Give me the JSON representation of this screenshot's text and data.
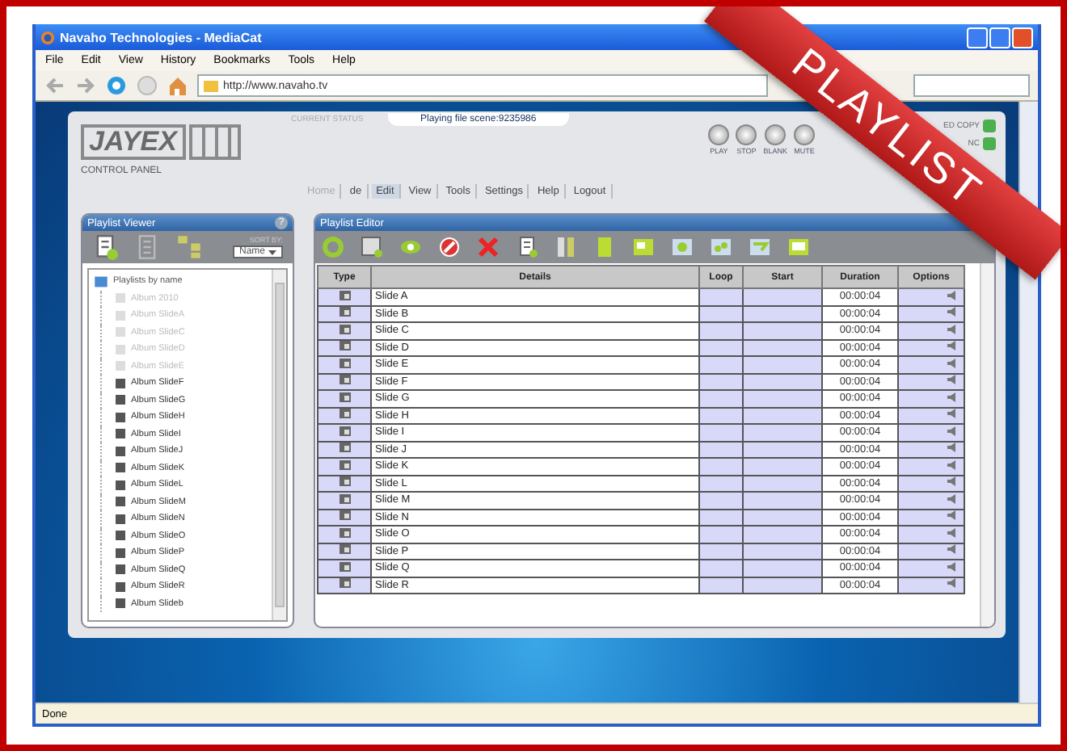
{
  "window": {
    "title": "Navaho Technologies - MediaCat"
  },
  "menu": [
    "File",
    "Edit",
    "View",
    "History",
    "Bookmarks",
    "Tools",
    "Help"
  ],
  "address": {
    "value": "http://www.navaho.tv"
  },
  "header": {
    "logo": "JAYEX",
    "subtitle": "CONTROL PANEL",
    "status_label": "CURRENT STATUS",
    "status_text": "Playing file scene:9235986",
    "player_buttons": [
      "PLAY",
      "STOP",
      "BLANK",
      "MUTE"
    ],
    "indicators": [
      "ED COPY",
      "NC"
    ]
  },
  "nav_tabs": [
    {
      "label": "Home",
      "selected": false,
      "disabled": true
    },
    {
      "label": "de",
      "selected": false,
      "disabled": false
    },
    {
      "label": "Edit",
      "selected": true,
      "disabled": false
    },
    {
      "label": "View",
      "selected": false,
      "disabled": false
    },
    {
      "label": "Tools",
      "selected": false,
      "disabled": false
    },
    {
      "label": "Settings",
      "selected": false,
      "disabled": false
    },
    {
      "label": "Help",
      "selected": false,
      "disabled": false
    },
    {
      "label": "Logout",
      "selected": false,
      "disabled": false
    }
  ],
  "playlist_viewer": {
    "title": "Playlist Viewer",
    "help": "?",
    "sort_label": "SORT BY:",
    "sort_value": "Name",
    "tree": {
      "label": "Playlists by name",
      "children": [
        {
          "label": "Album 2010",
          "dimmed": true
        },
        {
          "label": "Album SlideA",
          "dimmed": true
        },
        {
          "label": "Album SlideC",
          "dimmed": true
        },
        {
          "label": "Album SlideD",
          "dimmed": true
        },
        {
          "label": "Album SlideE",
          "dimmed": true
        },
        {
          "label": "Album SlideF",
          "dimmed": false
        },
        {
          "label": "Album SlideG",
          "dimmed": false
        },
        {
          "label": "Album SlideH",
          "dimmed": false
        },
        {
          "label": "Album SlideI",
          "dimmed": false
        },
        {
          "label": "Album SlideJ",
          "dimmed": false
        },
        {
          "label": "Album SlideK",
          "dimmed": false
        },
        {
          "label": "Album SlideL",
          "dimmed": false
        },
        {
          "label": "Album SlideM",
          "dimmed": false
        },
        {
          "label": "Album SlideN",
          "dimmed": false
        },
        {
          "label": "Album SlideO",
          "dimmed": false
        },
        {
          "label": "Album SlideP",
          "dimmed": false
        },
        {
          "label": "Album SlideQ",
          "dimmed": false
        },
        {
          "label": "Album SlideR",
          "dimmed": false
        },
        {
          "label": "Album Slideb",
          "dimmed": false
        }
      ]
    }
  },
  "playlist_editor": {
    "title": "Playlist Editor",
    "columns": [
      "Type",
      "Details",
      "Loop",
      "Start",
      "Duration",
      "Options"
    ],
    "rows": [
      {
        "details": "Slide A",
        "duration": "00:00:04"
      },
      {
        "details": "Slide B",
        "duration": "00:00:04"
      },
      {
        "details": "Slide C",
        "duration": "00:00:04"
      },
      {
        "details": "Slide D",
        "duration": "00:00:04"
      },
      {
        "details": "Slide E",
        "duration": "00:00:04"
      },
      {
        "details": "Slide F",
        "duration": "00:00:04"
      },
      {
        "details": "Slide G",
        "duration": "00:00:04"
      },
      {
        "details": "Slide H",
        "duration": "00:00:04"
      },
      {
        "details": "Slide I",
        "duration": "00:00:04"
      },
      {
        "details": "Slide J",
        "duration": "00:00:04"
      },
      {
        "details": "Slide K",
        "duration": "00:00:04"
      },
      {
        "details": "Slide L",
        "duration": "00:00:04"
      },
      {
        "details": "Slide M",
        "duration": "00:00:04"
      },
      {
        "details": "Slide N",
        "duration": "00:00:04"
      },
      {
        "details": "Slide O",
        "duration": "00:00:04"
      },
      {
        "details": "Slide P",
        "duration": "00:00:04"
      },
      {
        "details": "Slide Q",
        "duration": "00:00:04"
      },
      {
        "details": "Slide R",
        "duration": "00:00:04"
      }
    ]
  },
  "ribbon": "PLAYLIST",
  "status_bar": "Done"
}
